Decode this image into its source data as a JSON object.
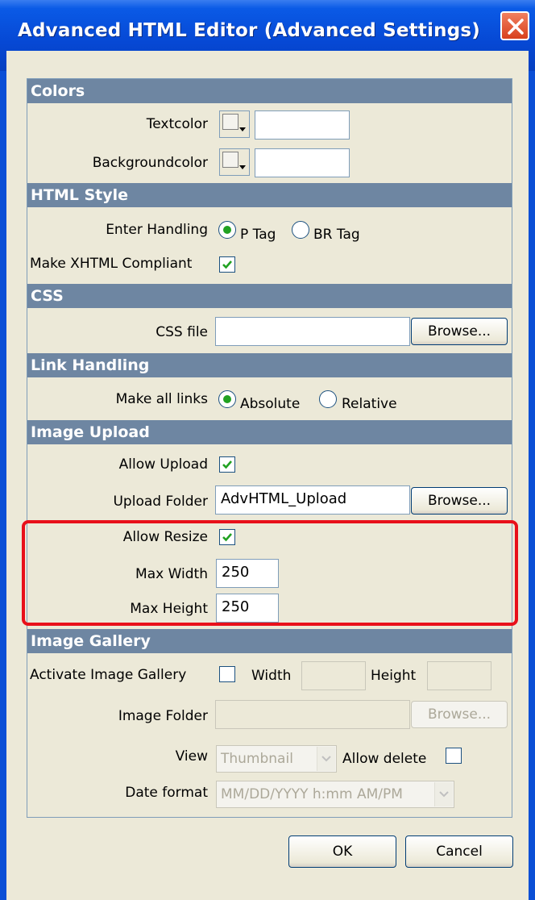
{
  "window": {
    "title": "Advanced HTML Editor (Advanced Settings)",
    "close_icon": "close-icon"
  },
  "sections": {
    "colors": "Colors",
    "html_style": "HTML Style",
    "css": "CSS",
    "link_handling": "Link Handling",
    "image_upload": "Image Upload",
    "image_gallery": "Image Gallery"
  },
  "colors": {
    "textcolor_label": "Textcolor",
    "textcolor_value": "",
    "backgroundcolor_label": "Backgroundcolor",
    "backgroundcolor_value": ""
  },
  "html_style": {
    "enter_handling_label": "Enter Handling",
    "p_tag_label": "P Tag",
    "br_tag_label": "BR Tag",
    "enter_handling_selected": "P Tag",
    "xhtml_label": "Make XHTML Compliant",
    "xhtml_checked": true
  },
  "css": {
    "css_file_label": "CSS file",
    "css_file_value": "",
    "browse_label": "Browse..."
  },
  "link_handling": {
    "make_all_links_label": "Make all links",
    "absolute_label": "Absolute",
    "relative_label": "Relative",
    "selected": "Absolute"
  },
  "image_upload": {
    "allow_upload_label": "Allow Upload",
    "allow_upload_checked": true,
    "upload_folder_label": "Upload Folder",
    "upload_folder_value": "AdvHTML_Upload",
    "browse_label": "Browse...",
    "allow_resize_label": "Allow Resize",
    "allow_resize_checked": true,
    "max_width_label": "Max Width",
    "max_width_value": "250",
    "max_height_label": "Max Height",
    "max_height_value": "250"
  },
  "image_gallery": {
    "activate_label": "Activate Image Gallery",
    "activate_checked": false,
    "width_label": "Width",
    "width_value": "",
    "height_label": "Height",
    "height_value": "",
    "image_folder_label": "Image Folder",
    "image_folder_value": "",
    "browse_label": "Browse...",
    "view_label": "View",
    "view_value": "Thumbnail",
    "allow_delete_label": "Allow delete",
    "allow_delete_checked": false,
    "date_format_label": "Date format",
    "date_format_value": "MM/DD/YYYY h:mm AM/PM"
  },
  "footer": {
    "ok_label": "OK",
    "cancel_label": "Cancel"
  },
  "colors_theme": {
    "titlebar": "#0648d4",
    "section_header": "#6e86a2",
    "highlight": "#e8101a",
    "check": "#21a121"
  }
}
